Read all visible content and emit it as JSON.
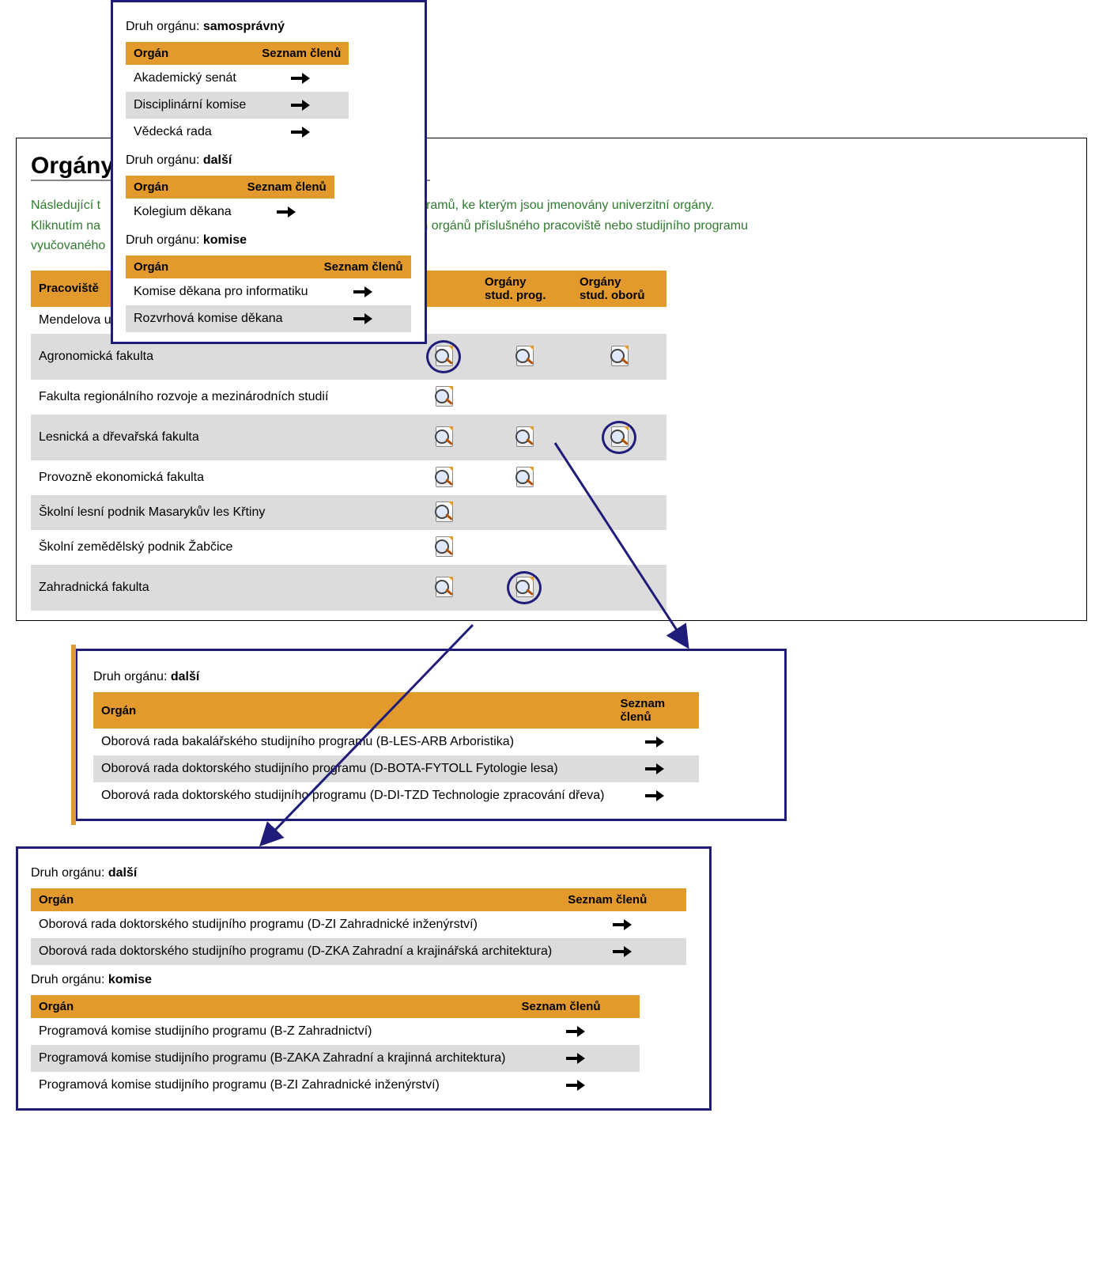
{
  "main": {
    "heading": "Orgány",
    "intro_line1_a": "Následující t",
    "intro_line1_b": "rogramů, ke kterým jsou jmenovány univerzitní orgány.",
    "intro_line2_a": "Kliknutím na",
    "intro_line2_b": "m orgánů příslušného pracoviště nebo studijního programu",
    "intro_line3_a": "vyučovaného",
    "cols": {
      "pracoviste": "Pracoviště",
      "organy_stud_prog_1": "Orgány",
      "organy_stud_prog_2": "stud. prog.",
      "organy_stud_oboru_1": "Orgány",
      "organy_stud_oboru_2": "stud. oborů"
    },
    "rows": [
      {
        "name": "Mendelova u",
        "c1": false,
        "c2": false,
        "c3": false
      },
      {
        "name": "Agronomická fakulta",
        "c1": true,
        "c1_circled": true,
        "c2": true,
        "c3": true
      },
      {
        "name": "Fakulta regionálního rozvoje a mezinárodních studií",
        "c1": true,
        "c2": false,
        "c3": false
      },
      {
        "name": "Lesnická a dřevařská fakulta",
        "c1": true,
        "c2": true,
        "c3": true,
        "c3_circled": true
      },
      {
        "name": "Provozně ekonomická fakulta",
        "c1": true,
        "c2": true,
        "c3": false
      },
      {
        "name": "Školní lesní podnik Masarykův les Křtiny",
        "c1": true,
        "c2": false,
        "c3": false
      },
      {
        "name": "Školní zemědělský podnik Žabčice",
        "c1": true,
        "c2": false,
        "c3": false
      },
      {
        "name": "Zahradnická fakulta",
        "c1": true,
        "c2": true,
        "c2_circled": true,
        "c3": false
      }
    ]
  },
  "popup_top": {
    "groups": [
      {
        "label": "Druh orgánu:",
        "value": "samosprávný",
        "cols": {
          "organ": "Orgán",
          "seznam": "Seznam členů"
        },
        "rows": [
          {
            "name": "Akademický senát"
          },
          {
            "name": "Disciplinární komise"
          },
          {
            "name": "Vědecká rada"
          }
        ]
      },
      {
        "label": "Druh orgánu:",
        "value": "další",
        "cols": {
          "organ": "Orgán",
          "seznam": "Seznam členů"
        },
        "rows": [
          {
            "name": "Kolegium děkana"
          }
        ]
      },
      {
        "label": "Druh orgánu:",
        "value": "komise",
        "cols": {
          "organ": "Orgán",
          "seznam": "Seznam členů"
        },
        "rows": [
          {
            "name": "Komise děkana pro informatiku"
          },
          {
            "name": "Rozvrhová komise děkana"
          }
        ]
      }
    ]
  },
  "popup_mid": {
    "label": "Druh orgánu:",
    "value": "další",
    "cols": {
      "organ": "Orgán",
      "seznam1": "Seznam",
      "seznam2": "členů"
    },
    "rows": [
      {
        "name": "Oborová rada bakalářského studijního programu (B-LES-ARB Arboristika)"
      },
      {
        "name": "Oborová rada doktorského studijního programu (D-BOTA-FYTOLL Fytologie lesa)"
      },
      {
        "name": "Oborová rada doktorského studijního programu (D-DI-TZD Technologie zpracování dřeva)"
      }
    ]
  },
  "popup_bottom": {
    "groups": [
      {
        "label": "Druh orgánu:",
        "value": "další",
        "cols": {
          "organ": "Orgán",
          "seznam": "Seznam členů"
        },
        "rows": [
          {
            "name": "Oborová rada doktorského studijního programu (D-ZI Zahradnické inženýrství)"
          },
          {
            "name": "Oborová rada doktorského studijního programu (D-ZKA Zahradní a krajinářská architektura)"
          }
        ]
      },
      {
        "label": "Druh orgánu:",
        "value": "komise",
        "cols": {
          "organ": "Orgán",
          "seznam": "Seznam členů"
        },
        "rows": [
          {
            "name": "Programová komise studijního programu (B-Z Zahradnictví)"
          },
          {
            "name": "Programová komise studijního programu (B-ZAKA Zahradní a krajinná architektura)"
          },
          {
            "name": "Programová komise studijního programu (B-ZI Zahradnické inženýrství)"
          }
        ]
      }
    ]
  }
}
